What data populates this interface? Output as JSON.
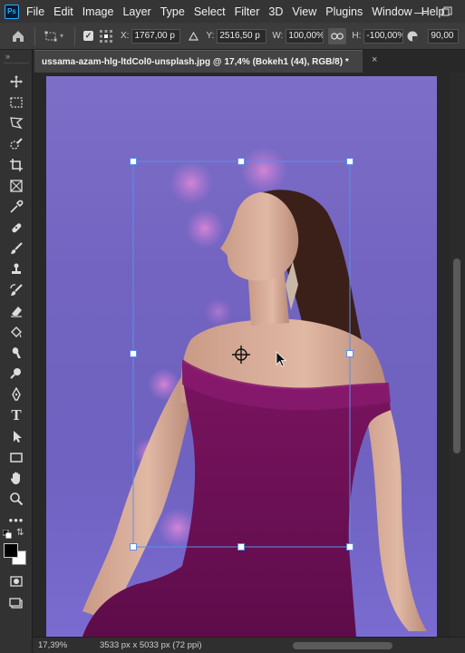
{
  "app": {
    "logo": "Ps",
    "menu": [
      "File",
      "Edit",
      "Image",
      "Layer",
      "Type",
      "Select",
      "Filter",
      "3D",
      "View",
      "Plugins",
      "Window",
      "Help"
    ]
  },
  "window_controls": [
    "minimize-icon",
    "restore-icon"
  ],
  "options": {
    "x_label": "X:",
    "x_value": "1767,00 p",
    "y_label": "Y:",
    "y_value": "2516,50 p",
    "w_label": "W:",
    "w_value": "100,00%",
    "h_label": "H:",
    "h_value": "-100,00%",
    "angle_value": "90,00"
  },
  "document": {
    "tab_title": "ussama-azam-hlg-ltdCol0-unsplash.jpg @ 17,4% (Bokeh1 (44), RGB/8) *",
    "close": "×"
  },
  "status": {
    "zoom": "17,39%",
    "doc_size": "3533 px x 5033 px (72 ppi)"
  },
  "colors": {
    "background": "#7a6bd0",
    "dress": "#6e0f55",
    "transform_box": "#5b8fe8"
  }
}
